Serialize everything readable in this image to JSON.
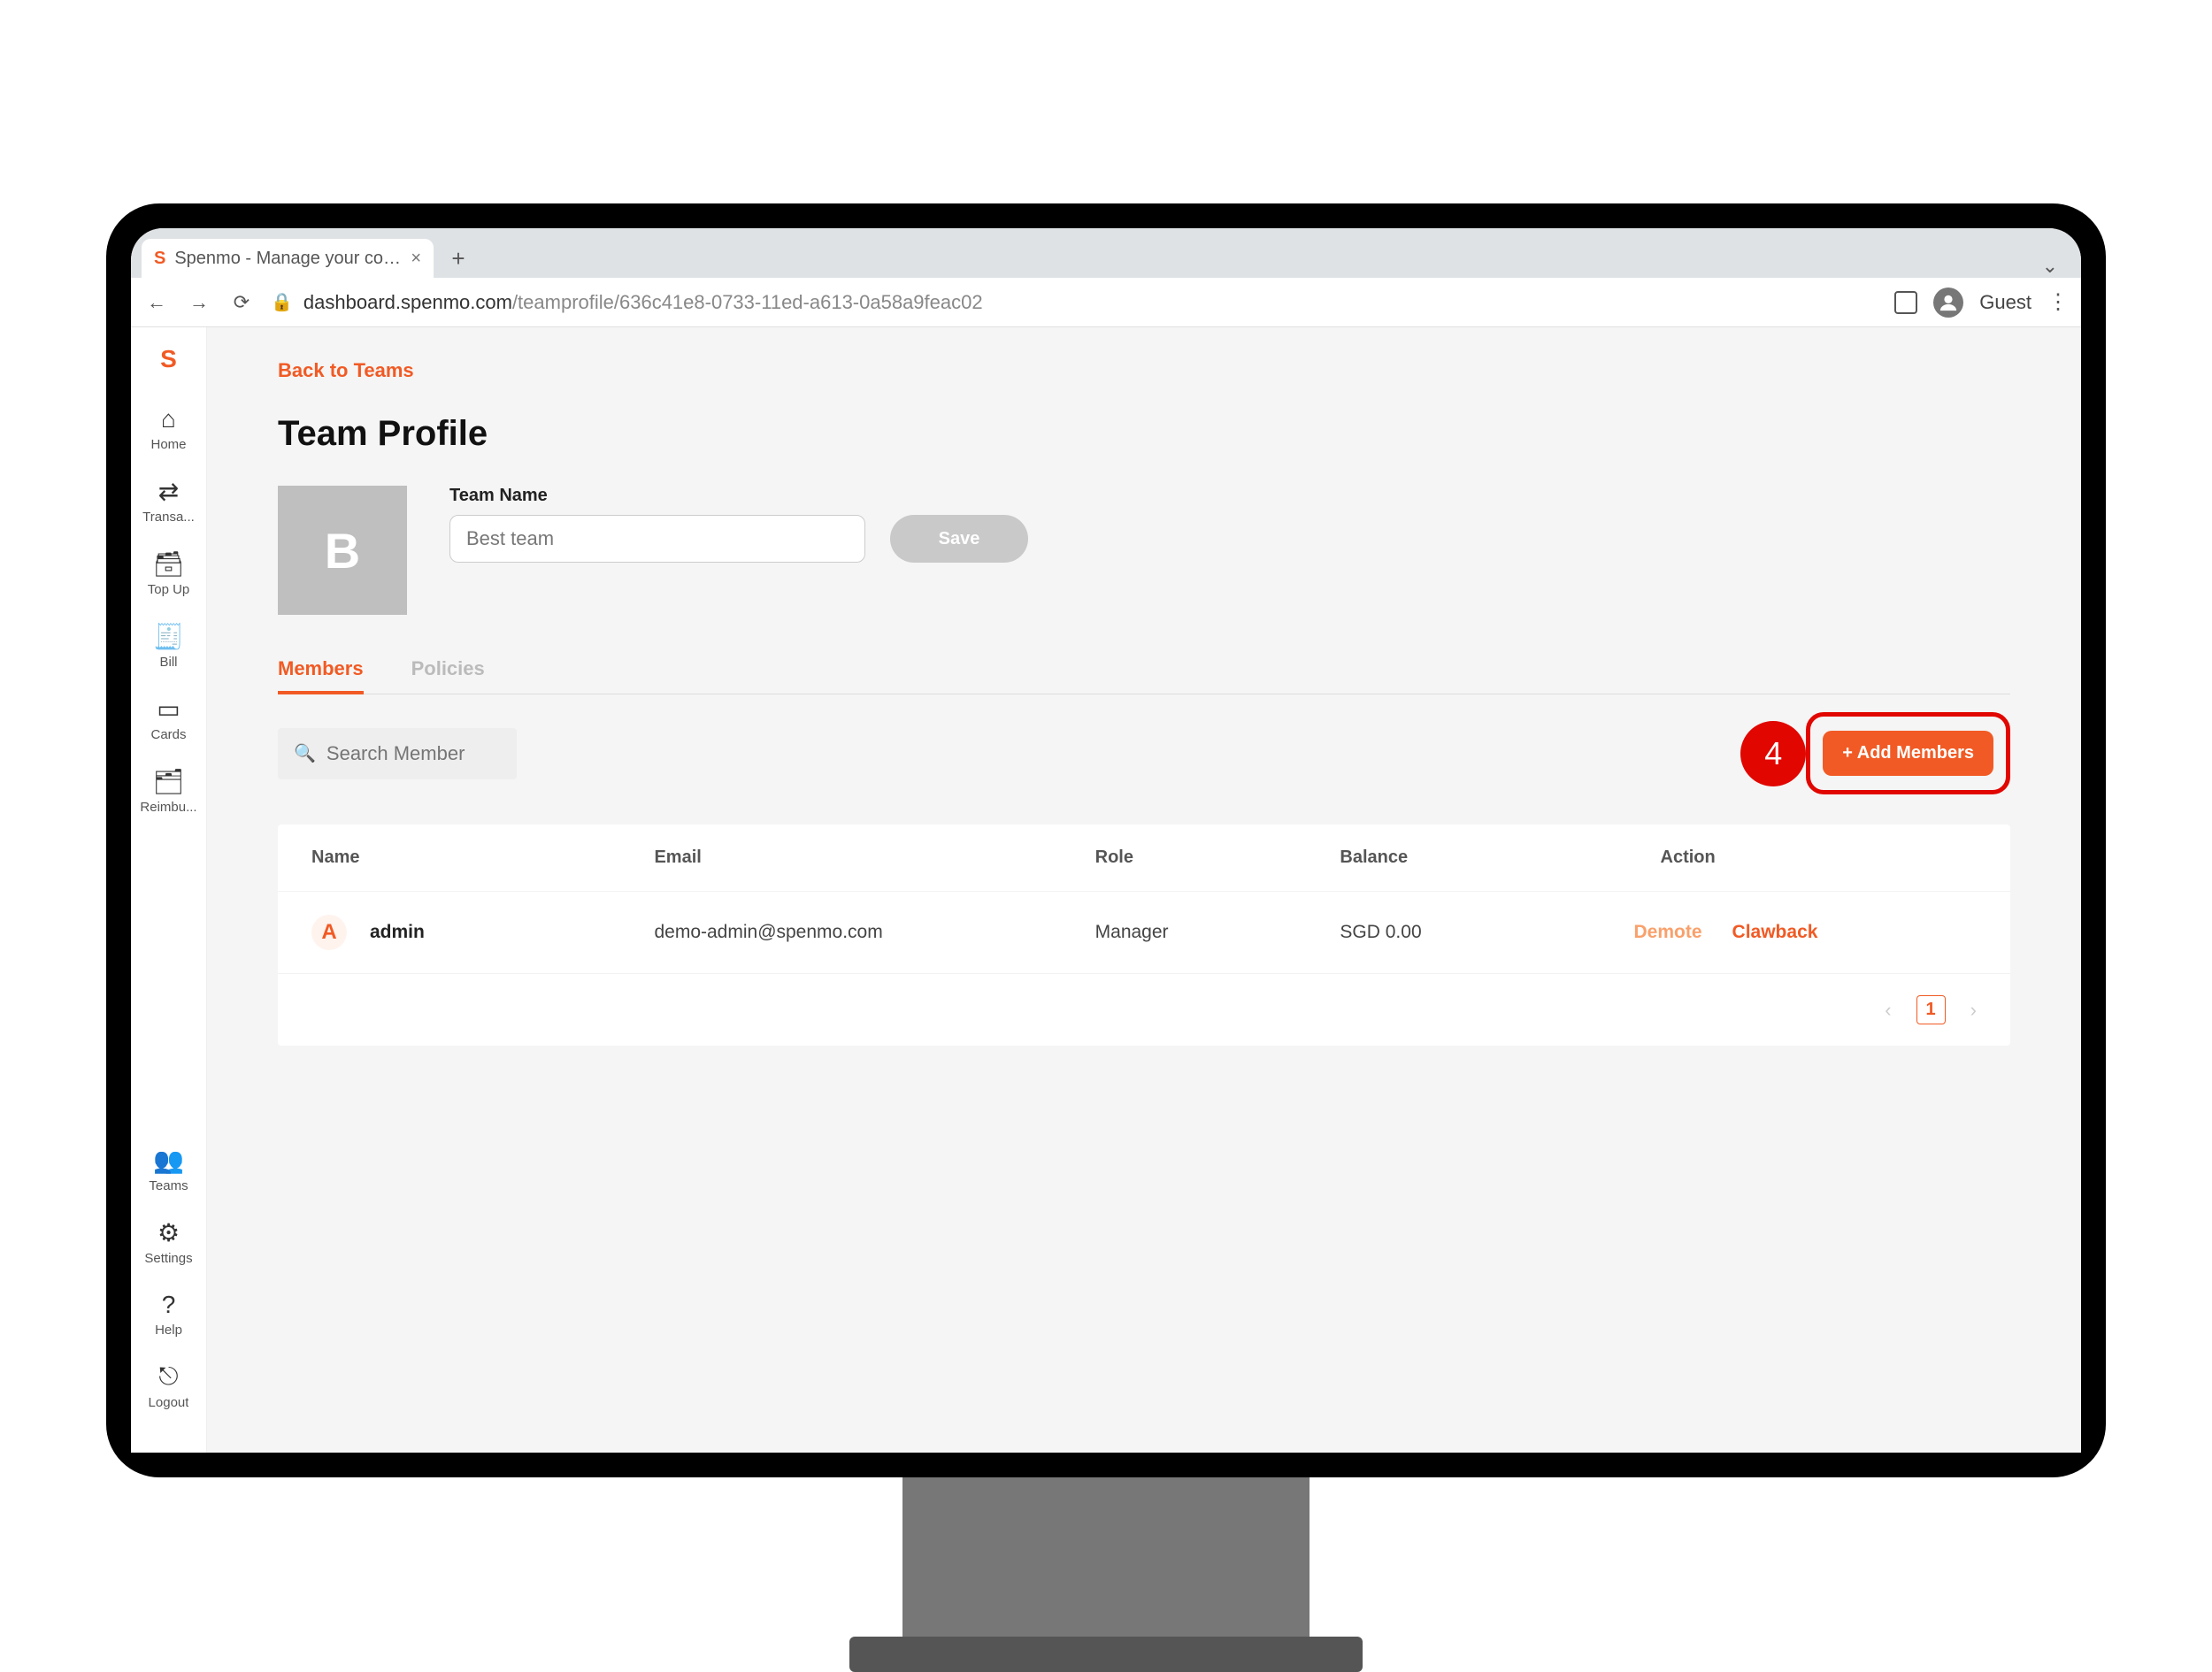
{
  "browser": {
    "tab_title": "Spenmo - Manage your compa",
    "url_host": "dashboard.spenmo.com",
    "url_path": "/teamprofile/636c41e8-0733-11ed-a613-0a58a9feac02",
    "guest_label": "Guest"
  },
  "sidebar": {
    "items": [
      {
        "label": "Home",
        "icon": "⌂"
      },
      {
        "label": "Transa...",
        "icon": "⇄"
      },
      {
        "label": "Top Up",
        "icon": "🗃"
      },
      {
        "label": "Bill",
        "icon": "🧾"
      },
      {
        "label": "Cards",
        "icon": "▭"
      },
      {
        "label": "Reimbu...",
        "icon": "🗂"
      }
    ],
    "bottom_items": [
      {
        "label": "Teams",
        "icon": "👥"
      },
      {
        "label": "Settings",
        "icon": "⚙"
      },
      {
        "label": "Help",
        "icon": "?"
      },
      {
        "label": "Logout",
        "icon": "⎋"
      }
    ]
  },
  "page": {
    "back_link": "Back to Teams",
    "title": "Team Profile",
    "avatar_letter": "B",
    "team_name_label": "Team Name",
    "team_name_value": "Best team",
    "save_label": "Save",
    "tabs": [
      {
        "label": "Members",
        "active": true
      },
      {
        "label": "Policies",
        "active": false
      }
    ],
    "search_placeholder": "Search Member",
    "add_button": "+ Add Members",
    "step_badge": "4",
    "columns": {
      "name": "Name",
      "email": "Email",
      "role": "Role",
      "balance": "Balance",
      "action": "Action"
    },
    "members": [
      {
        "avatar": "A",
        "name": "admin",
        "email": "demo-admin@spenmo.com",
        "role": "Manager",
        "balance": "SGD 0.00",
        "action_demote": "Demote",
        "action_clawback": "Clawback"
      }
    ],
    "pagination": {
      "current": "1"
    }
  }
}
